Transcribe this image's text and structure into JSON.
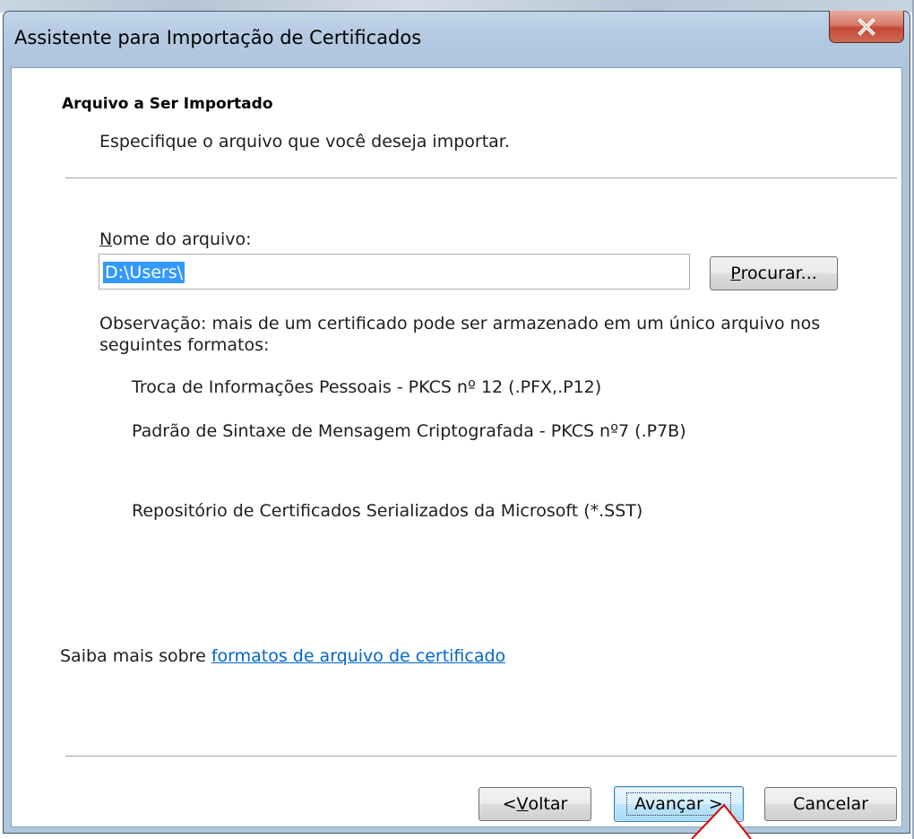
{
  "window": {
    "title": "Assistente para Importação de Certificados",
    "close_glyph": "X"
  },
  "header": {
    "title": "Arquivo a Ser Importado",
    "subtitle": "Especifique o arquivo que você deseja importar."
  },
  "file": {
    "label_mnemonic": "N",
    "label_rest": "ome do arquivo:",
    "value": "D:\\Users\\",
    "browse_mnemonic": "P",
    "browse_rest": "rocurar..."
  },
  "note": "Observação: mais de um certificado pode ser armazenado em um único arquivo nos seguintes formatos:",
  "formats": [
    "Troca de Informações Pessoais - PKCS nº 12 (.PFX,.P12)",
    "Padrão de Sintaxe de Mensagem Criptografada - PKCS nº7 (.P7B)",
    "Repositório de Certificados Serializados da Microsoft (*.SST)"
  ],
  "learn_more": {
    "prefix": "Saiba mais sobre ",
    "link": "formatos de arquivo de certificado"
  },
  "buttons": {
    "back_prefix": "< ",
    "back_mnemonic": "V",
    "back_rest": "oltar",
    "next": "Avançar >",
    "cancel": "Cancelar"
  },
  "colors": {
    "selection": "#3399ff",
    "link": "#0066cc",
    "annotation": "#e00000"
  }
}
